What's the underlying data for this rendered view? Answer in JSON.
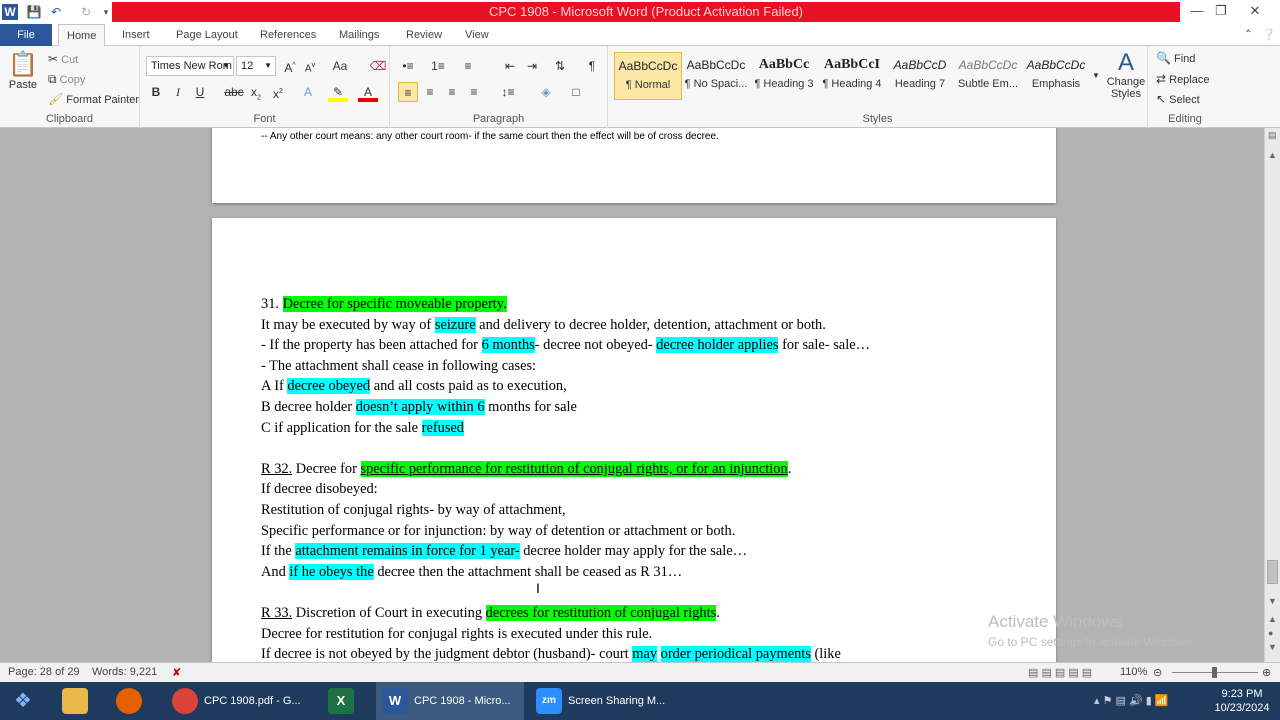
{
  "window": {
    "title": "CPC 1908 - Microsoft Word (Product Activation Failed)",
    "colors": {
      "title_bar": "#e81123",
      "accent": "#2b579a"
    }
  },
  "tabs": [
    "File",
    "Home",
    "Insert",
    "Page Layout",
    "References",
    "Mailings",
    "Review",
    "View"
  ],
  "ribbon": {
    "clipboard": {
      "paste": "Paste",
      "cut": "Cut",
      "copy": "Copy",
      "format_painter": "Format Painter",
      "group": "Clipboard"
    },
    "font": {
      "name": "Times New Rom",
      "size": "12",
      "group": "Font"
    },
    "paragraph": {
      "group": "Paragraph"
    },
    "styles": {
      "group": "Styles",
      "items": [
        {
          "sample": "AaBbCcDc",
          "name": "¶ Normal"
        },
        {
          "sample": "AaBbCcDc",
          "name": "¶ No Spaci..."
        },
        {
          "sample": "AaBbCc",
          "name": "¶ Heading 3"
        },
        {
          "sample": "AaBbCcI",
          "name": "¶ Heading 4"
        },
        {
          "sample": "AaBbCcD",
          "name": "Heading 7"
        },
        {
          "sample": "AaBbCcDc",
          "name": "Subtle Em..."
        },
        {
          "sample": "AaBbCcDc",
          "name": "Emphasis"
        }
      ],
      "change_styles": "Change Styles"
    },
    "editing": {
      "find": "Find",
      "replace": "Replace",
      "select": "Select",
      "group": "Editing"
    }
  },
  "document": {
    "prev_page_text": "-- Any other court means: any other court room- if the same court then the effect will be of cross decree.",
    "lines": [
      [
        {
          "t": "31. "
        },
        {
          "t": "Decree for specific moveable property.",
          "h": "g"
        }
      ],
      [
        {
          "t": "It may be executed by way of "
        },
        {
          "t": "seizure",
          "h": "c"
        },
        {
          "t": " and delivery to decree holder, detention, attachment or both."
        }
      ],
      [
        {
          "t": "- If the property has been attached for "
        },
        {
          "t": "6 months",
          "h": "c"
        },
        {
          "t": "- decree not obeyed- "
        },
        {
          "t": "decree holder applies",
          "h": "c"
        },
        {
          "t": " for sale- sale…"
        }
      ],
      [
        {
          "t": "- The attachment shall cease in following cases:"
        }
      ],
      [
        {
          "t": "A If "
        },
        {
          "t": "decree obeyed",
          "h": "c"
        },
        {
          "t": " and all costs paid as to execution,"
        }
      ],
      [
        {
          "t": "B decree holder "
        },
        {
          "t": "doesn’t apply within 6",
          "h": "c"
        },
        {
          "t": " months for sale"
        }
      ],
      [
        {
          "t": "C if application for the sale "
        },
        {
          "t": "refused",
          "h": "c"
        }
      ],
      [],
      [
        {
          "t": "R 32.",
          "u": 1
        },
        {
          "t": " Decree for "
        },
        {
          "t": "specific performance for restitution of conjugal rights, or for an injunction",
          "h": "g",
          "u": 1
        },
        {
          "t": "."
        }
      ],
      [
        {
          "t": "If decree disobeyed:"
        }
      ],
      [
        {
          "t": "Restitution of conjugal rights- by way of attachment,"
        }
      ],
      [
        {
          "t": "Specific performance or for injunction: by way of detention or attachment or both."
        }
      ],
      [
        {
          "t": "If the "
        },
        {
          "t": "attachment remains in force for 1 year-",
          "h": "c"
        },
        {
          "t": " decree holder may apply for the sale…"
        }
      ],
      [
        {
          "t": "And "
        },
        {
          "t": "if he obeys the",
          "h": "c"
        },
        {
          "t": " decree then the attachment shall be ceased as R 31…"
        }
      ],
      [],
      [
        {
          "t": "R 33.",
          "u": 1
        },
        {
          "t": " Discretion of Court in executing "
        },
        {
          "t": "decrees for restitution of conjugal rights",
          "h": "g"
        },
        {
          "t": "."
        }
      ],
      [
        {
          "t": "Decree for restitution for conjugal rights is executed under this rule."
        }
      ],
      [
        {
          "t": "If decree is not obeyed by the judgment debtor (husband)- court "
        },
        {
          "t": "may",
          "h": "c"
        },
        {
          "t": " "
        },
        {
          "t": "order periodical payments",
          "h": "c"
        },
        {
          "t": " (like"
        }
      ]
    ]
  },
  "status": {
    "page": "Page: 28 of 29",
    "words": "Words: 9,221",
    "zoom": "110%"
  },
  "watermark": {
    "line1": "Activate Windows",
    "line2": "Go to PC settings to activate Windows."
  },
  "taskbar": {
    "items": [
      {
        "label": "CPC 1908.pdf - G...",
        "icon": "chrome-icon"
      },
      {
        "label": "CPC 1908 - Micro...",
        "icon": "word-icon"
      },
      {
        "label": "Screen Sharing M...",
        "icon": "zoom-icon"
      }
    ],
    "time": "9:23 PM",
    "date": "10/23/2024"
  }
}
